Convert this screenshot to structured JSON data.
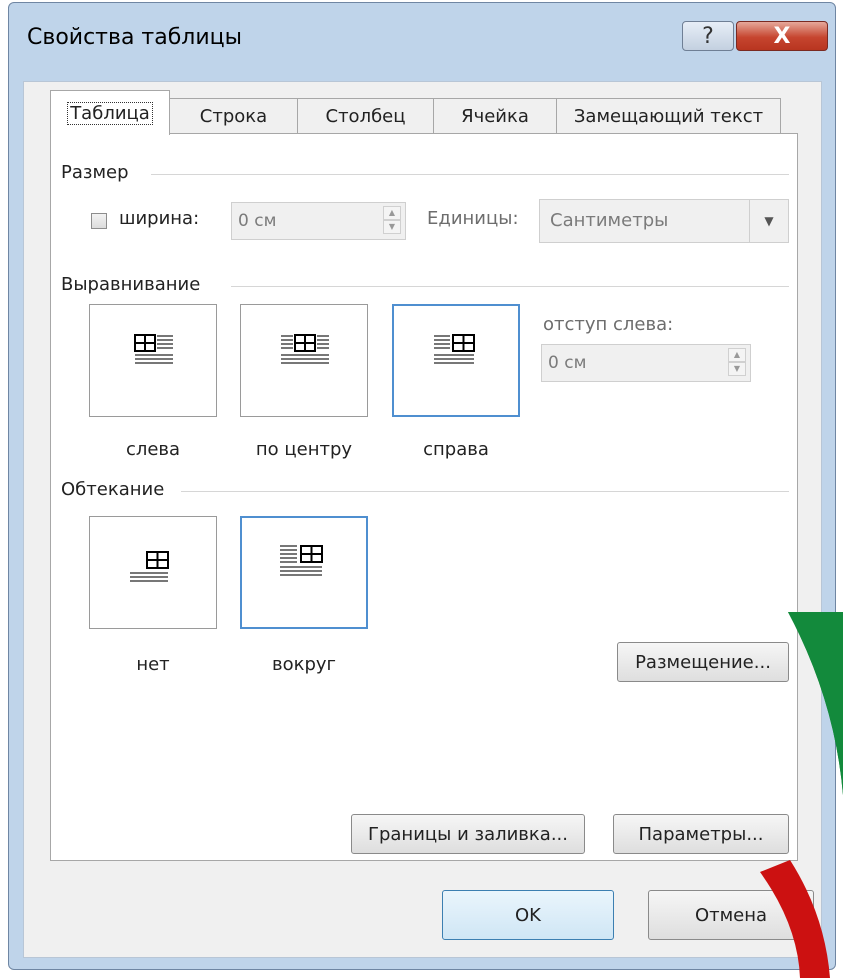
{
  "dialog": {
    "title": "Свойства таблицы",
    "help_label": "?",
    "close_label": "X"
  },
  "tabs": [
    {
      "label": "Таблица",
      "active": true
    },
    {
      "label": "Строка",
      "active": false
    },
    {
      "label": "Столбец",
      "active": false
    },
    {
      "label": "Ячейка",
      "active": false
    },
    {
      "label": "Замещающий текст",
      "active": false
    }
  ],
  "size": {
    "group_label": "Размер",
    "width_checkbox_label": "ширина:",
    "width_checked": false,
    "width_value": "0 см",
    "units_label": "Единицы:",
    "units_value": "Сантиметры"
  },
  "alignment": {
    "group_label": "Выравнивание",
    "options": [
      {
        "label": "слева",
        "selected": false
      },
      {
        "label": "по центру",
        "selected": false
      },
      {
        "label": "справа",
        "selected": true
      }
    ],
    "indent_label": "отступ слева:",
    "indent_value": "0 см"
  },
  "wrapping": {
    "group_label": "Обтекание",
    "options": [
      {
        "label": "нет",
        "selected": false
      },
      {
        "label": "вокруг",
        "selected": true
      }
    ],
    "positioning_button": "Размещение..."
  },
  "buttons": {
    "borders": "Границы и заливка...",
    "options": "Параметры...",
    "ok": "OK",
    "cancel": "Отмена"
  },
  "colors": {
    "selection_border": "#4f8fd0",
    "close_button": "#c6452f",
    "arc_green": "#138a3c",
    "arc_red": "#cc1111"
  }
}
